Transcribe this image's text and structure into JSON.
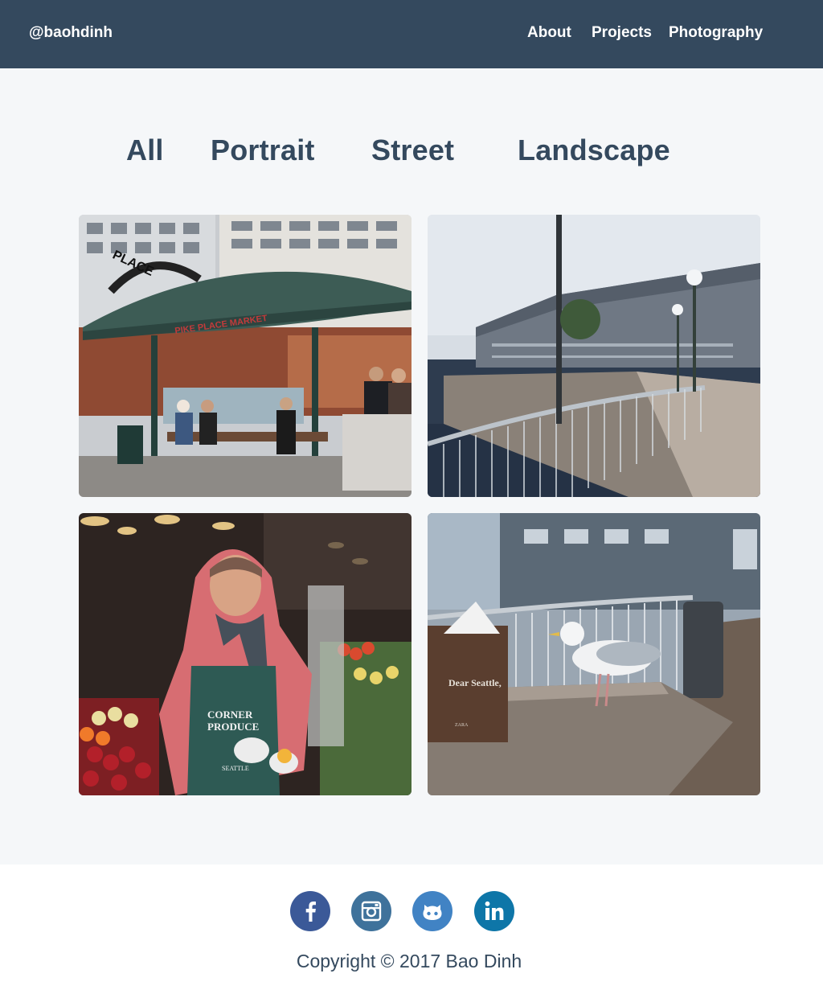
{
  "header": {
    "brand": "@baohdinh",
    "nav": [
      {
        "label": "About"
      },
      {
        "label": "Projects"
      },
      {
        "label": "Photography"
      }
    ]
  },
  "filters": [
    "All",
    "Portrait",
    "Street",
    "Landscape"
  ],
  "gallery": {
    "photos": [
      {
        "subject": "pike-place-market-shelter"
      },
      {
        "subject": "waterfront-pier-railing"
      },
      {
        "subject": "produce-vendor-hoodie"
      },
      {
        "subject": "seagull-on-picnic-table"
      }
    ],
    "photo_texts": {
      "market_sign": "PIKE PLACE MARKET",
      "arch_sign": "PLACE",
      "apron_line1": "CORNER",
      "apron_line2": "PRODUCE",
      "apron_line3": "SEATTLE",
      "bag_text": "Dear Seattle,",
      "bag_brand": "ZARA"
    }
  },
  "footer": {
    "social": [
      {
        "name": "facebook",
        "color": "#3b5998"
      },
      {
        "name": "instagram",
        "color": "#3f729b"
      },
      {
        "name": "github",
        "color": "#4183c4"
      },
      {
        "name": "linkedin",
        "color": "#0e76a8"
      }
    ],
    "copyright": "Copyright © 2017 Bao Dinh"
  },
  "colors": {
    "header_bg": "#34495e",
    "page_bg": "#f5f7f9",
    "text": "#34495e"
  }
}
